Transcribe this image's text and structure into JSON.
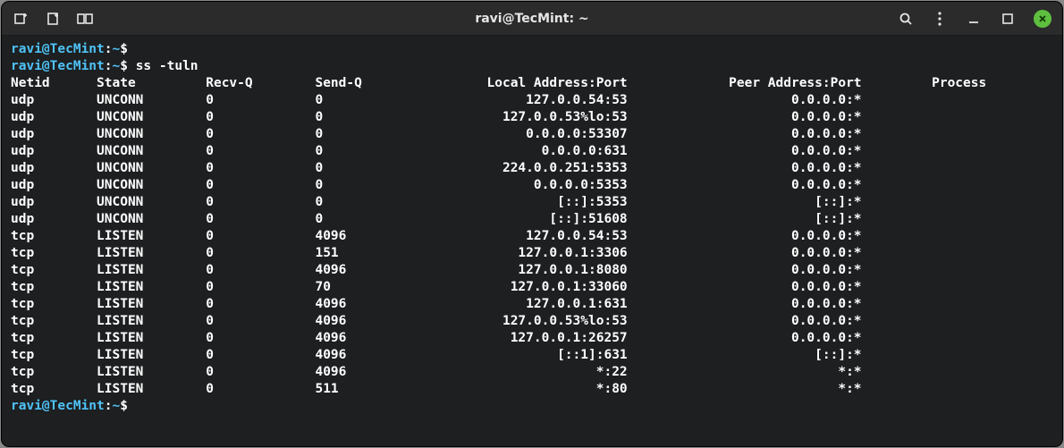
{
  "window": {
    "title": "ravi@TecMint: ~"
  },
  "prompt": {
    "user_host": "ravi@TecMint",
    "sep1": ":",
    "path": "~",
    "sigil": "$"
  },
  "commands": {
    "line1": "",
    "line2": "ss -tuln"
  },
  "table": {
    "headers": {
      "netid": "Netid",
      "state": "State",
      "recvq": "Recv-Q",
      "sendq": "Send-Q",
      "local": "Local Address:Port",
      "peer": "Peer Address:Port",
      "process": "Process"
    },
    "rows": [
      {
        "netid": "udp",
        "state": "UNCONN",
        "recvq": "0",
        "sendq": "0",
        "local": "127.0.0.54:53",
        "peer": "0.0.0.0:*"
      },
      {
        "netid": "udp",
        "state": "UNCONN",
        "recvq": "0",
        "sendq": "0",
        "local": "127.0.0.53%lo:53",
        "peer": "0.0.0.0:*"
      },
      {
        "netid": "udp",
        "state": "UNCONN",
        "recvq": "0",
        "sendq": "0",
        "local": "0.0.0.0:53307",
        "peer": "0.0.0.0:*"
      },
      {
        "netid": "udp",
        "state": "UNCONN",
        "recvq": "0",
        "sendq": "0",
        "local": "0.0.0.0:631",
        "peer": "0.0.0.0:*"
      },
      {
        "netid": "udp",
        "state": "UNCONN",
        "recvq": "0",
        "sendq": "0",
        "local": "224.0.0.251:5353",
        "peer": "0.0.0.0:*"
      },
      {
        "netid": "udp",
        "state": "UNCONN",
        "recvq": "0",
        "sendq": "0",
        "local": "0.0.0.0:5353",
        "peer": "0.0.0.0:*"
      },
      {
        "netid": "udp",
        "state": "UNCONN",
        "recvq": "0",
        "sendq": "0",
        "local": "[::]:5353",
        "peer": "[::]:*"
      },
      {
        "netid": "udp",
        "state": "UNCONN",
        "recvq": "0",
        "sendq": "0",
        "local": "[::]:51608",
        "peer": "[::]:*"
      },
      {
        "netid": "tcp",
        "state": "LISTEN",
        "recvq": "0",
        "sendq": "4096",
        "local": "127.0.0.54:53",
        "peer": "0.0.0.0:*"
      },
      {
        "netid": "tcp",
        "state": "LISTEN",
        "recvq": "0",
        "sendq": "151",
        "local": "127.0.0.1:3306",
        "peer": "0.0.0.0:*"
      },
      {
        "netid": "tcp",
        "state": "LISTEN",
        "recvq": "0",
        "sendq": "4096",
        "local": "127.0.0.1:8080",
        "peer": "0.0.0.0:*"
      },
      {
        "netid": "tcp",
        "state": "LISTEN",
        "recvq": "0",
        "sendq": "70",
        "local": "127.0.0.1:33060",
        "peer": "0.0.0.0:*"
      },
      {
        "netid": "tcp",
        "state": "LISTEN",
        "recvq": "0",
        "sendq": "4096",
        "local": "127.0.0.1:631",
        "peer": "0.0.0.0:*"
      },
      {
        "netid": "tcp",
        "state": "LISTEN",
        "recvq": "0",
        "sendq": "4096",
        "local": "127.0.0.53%lo:53",
        "peer": "0.0.0.0:*"
      },
      {
        "netid": "tcp",
        "state": "LISTEN",
        "recvq": "0",
        "sendq": "4096",
        "local": "127.0.0.1:26257",
        "peer": "0.0.0.0:*"
      },
      {
        "netid": "tcp",
        "state": "LISTEN",
        "recvq": "0",
        "sendq": "4096",
        "local": "[::1]:631",
        "peer": "[::]:*"
      },
      {
        "netid": "tcp",
        "state": "LISTEN",
        "recvq": "0",
        "sendq": "4096",
        "local": "*:22",
        "peer": "*:*"
      },
      {
        "netid": "tcp",
        "state": "LISTEN",
        "recvq": "0",
        "sendq": "511",
        "local": "*:80",
        "peer": "*:*"
      }
    ]
  },
  "colors": {
    "bg": "#1d1f21",
    "prompt": "#4fc3f7",
    "titlebar": "#2b2b2b",
    "close_btn": "#5fbf3f"
  }
}
